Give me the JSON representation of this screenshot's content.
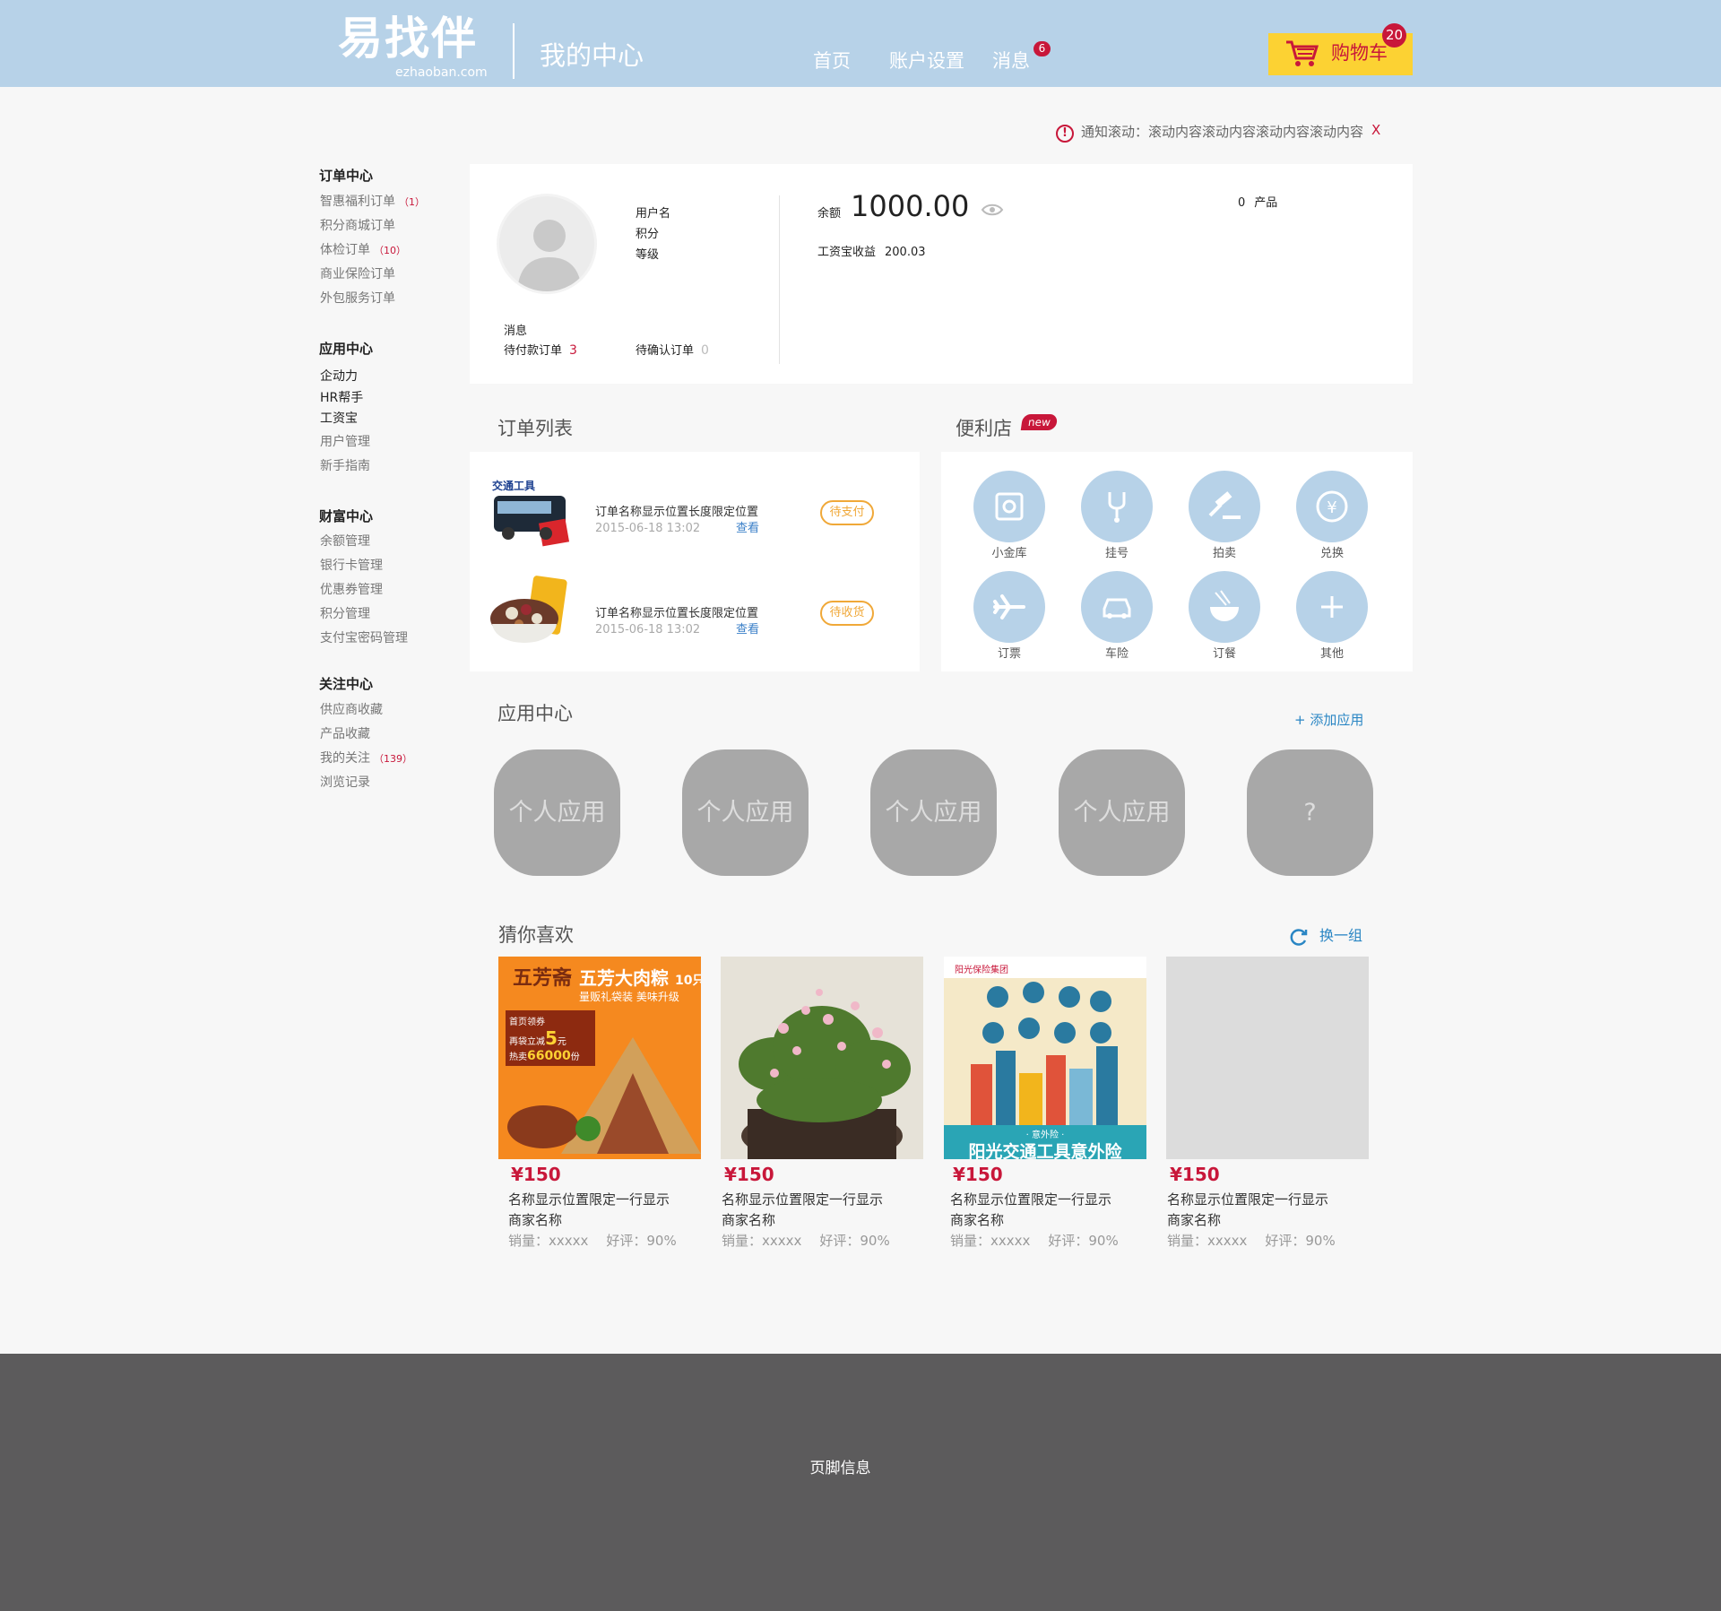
{
  "header": {
    "logo_text": "易找伴",
    "logo_domain": "ezhaoban.com",
    "page_title": "我的中心",
    "nav": {
      "home": "首页",
      "account": "账户设置",
      "messages": "消息",
      "messages_count": "6"
    },
    "cart": {
      "label": "购物车",
      "count": "20"
    }
  },
  "notice": {
    "text": "通知滚动：滚动内容滚动内容滚动内容滚动内容",
    "close": "X"
  },
  "sidebar": {
    "groups": [
      {
        "title": "订单中心",
        "items": [
          {
            "label": "智惠福利订单",
            "count": "（1）"
          },
          {
            "label": "积分商城订单",
            "count": ""
          },
          {
            "label": "体检订单",
            "count": "（10）"
          },
          {
            "label": "商业保险订单",
            "count": ""
          },
          {
            "label": "外包服务订单",
            "count": ""
          }
        ]
      },
      {
        "title": "应用中心",
        "items": [
          {
            "label": "企动力",
            "count": ""
          },
          {
            "label": "HR帮手",
            "count": ""
          },
          {
            "label": "工资宝",
            "count": ""
          },
          {
            "label": "用户管理",
            "count": ""
          },
          {
            "label": "新手指南",
            "count": ""
          }
        ]
      },
      {
        "title": "财富中心",
        "items": [
          {
            "label": "余额管理",
            "count": ""
          },
          {
            "label": "银行卡管理",
            "count": ""
          },
          {
            "label": "优惠券管理",
            "count": ""
          },
          {
            "label": "积分管理",
            "count": ""
          },
          {
            "label": "支付宝密码管理",
            "count": ""
          }
        ]
      },
      {
        "title": "关注中心",
        "items": [
          {
            "label": "供应商收藏",
            "count": ""
          },
          {
            "label": "产品收藏",
            "count": ""
          },
          {
            "label": "我的关注",
            "count": "（139）"
          },
          {
            "label": "浏览记录",
            "count": ""
          }
        ]
      }
    ]
  },
  "profile": {
    "username_label": "用户名",
    "points_label": "积分",
    "level_label": "等级",
    "messages_label": "消息",
    "pending_pay_label": "待付款订单",
    "pending_pay_count": "3",
    "pending_confirm_label": "待确认订单",
    "pending_confirm_count": "0",
    "balance_label": "余额",
    "balance_value": "1000.00",
    "salary_label": "工资宝收益",
    "salary_value": "200.03",
    "products_count": "0",
    "products_label": "产品"
  },
  "orders": {
    "title": "订单列表",
    "items": [
      {
        "name": "订单名称显示位置长度限定位置",
        "time": "2015-06-18  13:02",
        "view": "查看",
        "status": "待支付",
        "thumb_text": "交通工具"
      },
      {
        "name": "订单名称显示位置长度限定位置",
        "time": "2015-06-18  13:02",
        "view": "查看",
        "status": "待收货",
        "thumb_text": ""
      }
    ]
  },
  "store": {
    "title": "便利店",
    "badge": "new",
    "items": [
      {
        "label": "小金库",
        "icon": "safe-icon"
      },
      {
        "label": "挂号",
        "icon": "stethoscope-icon"
      },
      {
        "label": "拍卖",
        "icon": "gavel-icon"
      },
      {
        "label": "兑换",
        "icon": "yen-coin-icon"
      },
      {
        "label": "订票",
        "icon": "airplane-icon"
      },
      {
        "label": "车险",
        "icon": "car-icon"
      },
      {
        "label": "订餐",
        "icon": "bowl-icon"
      },
      {
        "label": "其他",
        "icon": "plus-icon"
      }
    ]
  },
  "apps": {
    "title": "应用中心",
    "add_label": "+ 添加应用",
    "tiles": [
      "个人应用",
      "个人应用",
      "个人应用",
      "个人应用",
      "?"
    ]
  },
  "recommend": {
    "title": "猜你喜欢",
    "refresh_label": "换一组",
    "products": [
      {
        "price": "¥150",
        "name": "名称显示位置限定一行显示",
        "shop": "商家名称",
        "sales": "销量：xxxxx",
        "rating": "好评：90%",
        "img_title": "五芳斋",
        "img_text": "五芳大肉粽",
        "img_count": "10只",
        "img_sub1": "量贩礼袋装  美味升级",
        "img_promo1": "首页领券",
        "img_promo2": "再袋立减",
        "img_promo_num": "5",
        "img_promo_unit": "元",
        "img_hot": "热卖",
        "img_hot_num": "66000",
        "img_hot_unit": "份"
      },
      {
        "price": "¥150",
        "name": "名称显示位置限定一行显示",
        "shop": "商家名称",
        "sales": "销量：xxxxx",
        "rating": "好评：90%"
      },
      {
        "price": "¥150",
        "name": "名称显示位置限定一行显示",
        "shop": "商家名称",
        "sales": "销量：xxxxx",
        "rating": "好评：90%",
        "img_title": "阳光保险集团",
        "img_text": "阳光交通工具意外险",
        "img_sub": "· 意外险 ·"
      },
      {
        "price": "¥150",
        "name": "名称显示位置限定一行显示",
        "shop": "商家名称",
        "sales": "销量：xxxxx",
        "rating": "好评：90%"
      }
    ]
  },
  "footer": {
    "text": "页脚信息"
  },
  "colors": {
    "header_bg": "#b7d2e8",
    "accent_red": "#c8173a",
    "cart_yellow": "#fcd233",
    "footer_bg": "#5c5b5c",
    "link_blue": "#2a86c4",
    "status_orange": "#f0a838"
  }
}
